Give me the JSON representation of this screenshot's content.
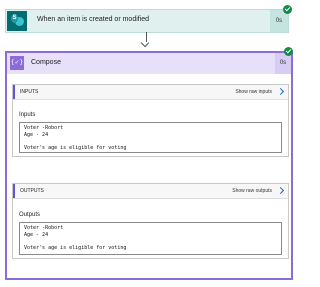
{
  "trigger": {
    "title": "When an item is created or modified",
    "duration": "0s",
    "icon": "sharepoint-icon"
  },
  "compose": {
    "title": "Compose",
    "duration": "0s",
    "icon": "compose-braces-icon",
    "icon_glyph": "{✓}"
  },
  "inputs_section": {
    "header": "INPUTS",
    "raw_link": "Show raw inputs",
    "field_label": "Inputs",
    "lines": [
      "Voter -Robort",
      "Age - 24",
      "",
      "Voter's age is eligible for voting"
    ]
  },
  "outputs_section": {
    "header": "OUTPUTS",
    "raw_link": "Show raw outputs",
    "field_label": "Outputs",
    "lines": [
      "Voter -Robort",
      "Age - 24",
      "",
      "Voter's age is eligible for voting"
    ]
  },
  "colors": {
    "trigger_bg": "#dff0ee",
    "compose_border": "#8c6cd8",
    "success": "#128a4a",
    "link": "#1a66c9"
  }
}
